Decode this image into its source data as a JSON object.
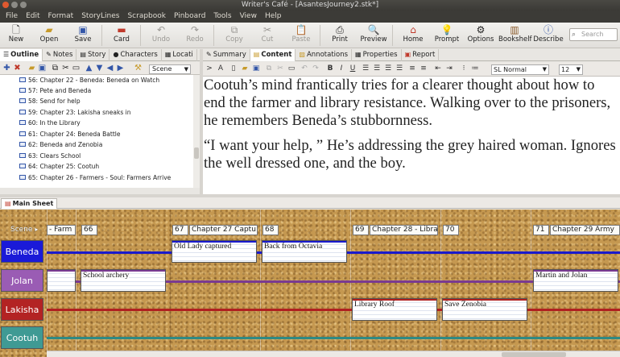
{
  "window": {
    "title": "Writer's Café - [AsantesJourney2.stk*]"
  },
  "menu": [
    "File",
    "Edit",
    "Format",
    "StoryLines",
    "Scrapbook",
    "Pinboard",
    "Tools",
    "View",
    "Help"
  ],
  "toolbar": {
    "new": "New",
    "open": "Open",
    "save": "Save",
    "card": "Card",
    "undo": "Undo",
    "redo": "Redo",
    "copy": "Copy",
    "cut": "Cut",
    "paste": "Paste",
    "print": "Print",
    "preview": "Preview",
    "home": "Home",
    "prompt": "Prompt",
    "options": "Options",
    "bookshelf": "Bookshelf",
    "describe": "Describe",
    "search_placeholder": "Search"
  },
  "left_tabs": [
    "Outline",
    "Notes",
    "Story",
    "Characters",
    "Locati"
  ],
  "scene_select": "Scene",
  "outline": [
    "56: Chapter 22 - Beneda: Beneda on Watch",
    "57: Pete and Beneda",
    "58: Send for help",
    "59: Chapter 23: Lakisha sneaks in",
    "60: In the Library",
    "61: Chapter 24: Beneda Battle",
    "62: Beneda and Zenobia",
    "63: Clears School",
    "64: Chapter 25: Cootuh",
    "65: Chapter 26 - Farmers - Soul: Farmers Arrive"
  ],
  "right_tabs": [
    "Summary",
    "Content",
    "Annotations",
    "Properties",
    "Report"
  ],
  "style_select": "SL Normal",
  "size_select": "12",
  "content": {
    "p1": "Cootuh’s mind frantically tries for a clearer thought about how to end the farmer and library resistance. Walking over to the prisoners, he remembers Beneda’s stubbornness.",
    "p2": "“I want your help, ” He’s addressing the grey haired woman. Ignores the well dressed one, and the boy."
  },
  "sheet_tab": "Main Sheet",
  "timeline": {
    "scene_label": "Scene",
    "chapters": [
      {
        "text": "- Farm"
      },
      {
        "text": "66"
      },
      {
        "text": "67"
      },
      {
        "text": "Chapter 27 Captu"
      },
      {
        "text": "68"
      },
      {
        "text": "69"
      },
      {
        "text": "Chapter 28 - Libra"
      },
      {
        "text": "70"
      },
      {
        "text": "71"
      },
      {
        "text": "Chapter 29 Army"
      }
    ],
    "strands": [
      {
        "name": "Beneda",
        "color": "#1a1ad8",
        "line": "#1a1acc"
      },
      {
        "name": "Jolan",
        "color": "#9a5cb4",
        "line": "#7a3a90"
      },
      {
        "name": "Lakisha",
        "color": "#b32323",
        "line": "#b02020"
      },
      {
        "name": "Cootuh",
        "color": "#3f9a94",
        "line": "#2f8a84"
      }
    ],
    "cards": [
      {
        "text": "Old Lady captured",
        "strand": "Beneda"
      },
      {
        "text": "Back from Octavia",
        "strand": "Beneda"
      },
      {
        "text": "",
        "strand": "Jolan"
      },
      {
        "text": "School archery",
        "strand": "Jolan"
      },
      {
        "text": "Martin and Jolan",
        "strand": "Jolan"
      },
      {
        "text": "Library Roof",
        "strand": "Lakisha"
      },
      {
        "text": "Save Zenobia",
        "strand": "Lakisha"
      }
    ]
  }
}
